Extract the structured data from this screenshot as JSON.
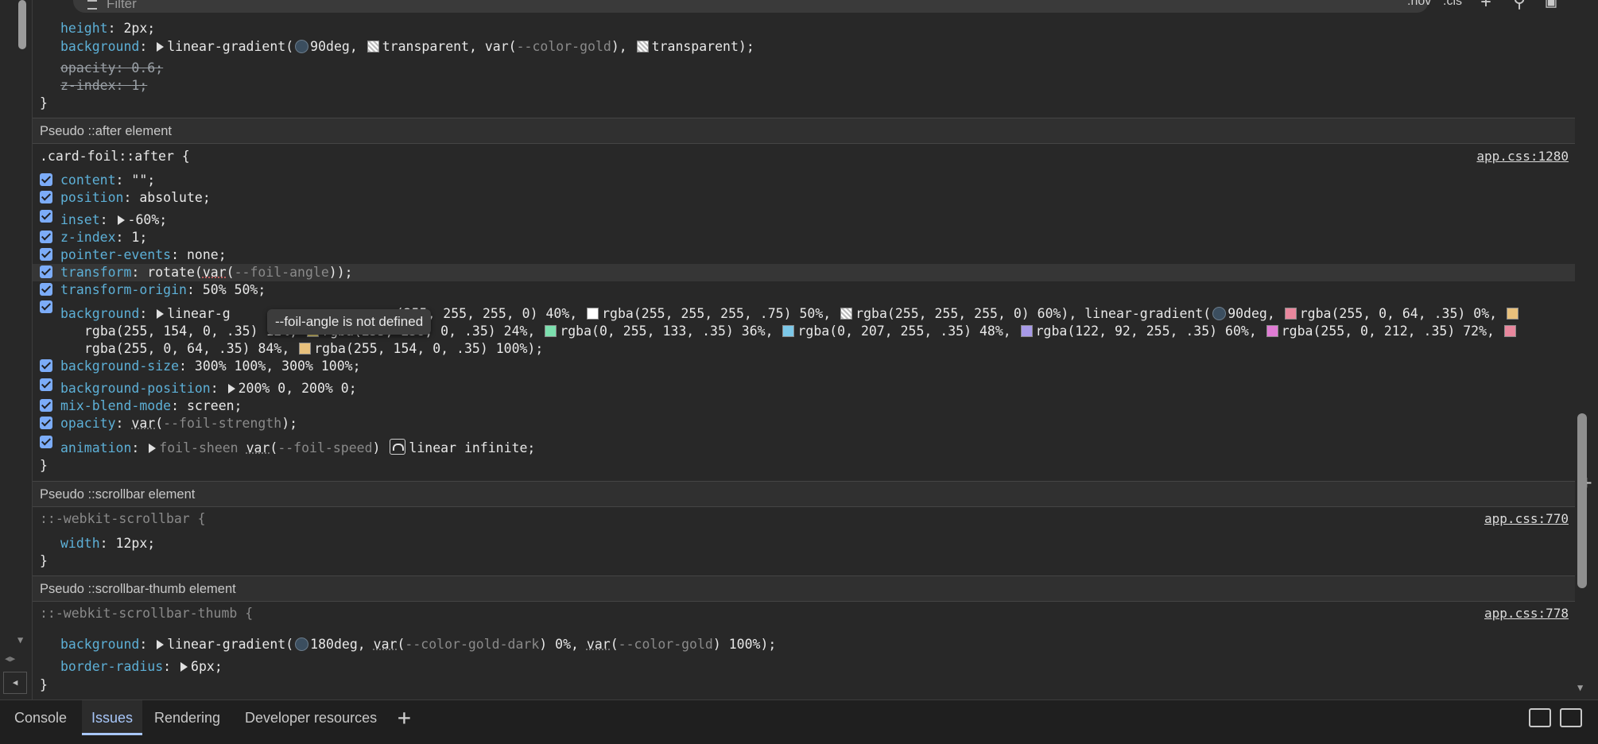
{
  "toolbar": {
    "filter_placeholder": "Filter",
    "hov_label": ":hov",
    "cls_label": ".cls"
  },
  "rule_prev": {
    "lines": [
      {
        "prop": "height",
        "value": "2px;"
      },
      {
        "prop": "background",
        "value_parts": [
          "linear-gradient(",
          "90deg, ",
          "transparent, ",
          "var(",
          "--color-gold",
          "), ",
          "transparent);"
        ]
      },
      {
        "prop": "opacity",
        "value": "0.6;"
      },
      {
        "prop": "z-index",
        "value": "1;"
      }
    ],
    "close": "}"
  },
  "after": {
    "header": "Pseudo ::after element",
    "selector": ".card-foil::after {",
    "source": "app.css:1280",
    "content": {
      "prop": "content",
      "value": "\"\";"
    },
    "position": {
      "prop": "position",
      "value": "absolute;"
    },
    "inset": {
      "prop": "inset",
      "value": "-60%;"
    },
    "zindex": {
      "prop": "z-index",
      "value": "1;"
    },
    "pointer": {
      "prop": "pointer-events",
      "value": "none;"
    },
    "transform": {
      "prop": "transform",
      "v1": "rotate(",
      "v2": "var",
      "v3": "(",
      "v4": "--foil-angle",
      "v5": "));"
    },
    "origin": {
      "prop": "transform-origin",
      "value": "50% 50%;"
    },
    "background": {
      "prop": "background",
      "line1a": "linear-g",
      "line1b": "(255, 255, 255, 0) 40%,",
      "line1c": "rgba(255, 255, 255, .75) 50%,",
      "line1d": "rgba(255, 255, 255, 0) 60%), linear-gradient(",
      "line1e": "90deg,",
      "line1f": "rgba(255, 0, 64, .35) 0%,",
      "line2a": "rgba(255, 154, 0, .35) 12%,",
      "line2b": "rgba(255, 238, 0, .35) 24%,",
      "line2c": "rgba(0, 255, 133, .35) 36%,",
      "line2d": "rgba(0, 207, 255, .35) 48%,",
      "line2e": "rgba(122, 92, 255, .35) 60%,",
      "line2f": "rgba(255, 0, 212, .35) 72%,",
      "line3a": "rgba(255, 0, 64, .35) 84%,",
      "line3b": "rgba(255, 154, 0, .35) 100%);"
    },
    "bgsize": {
      "prop": "background-size",
      "value": "300% 100%, 300% 100%;"
    },
    "bgpos": {
      "prop": "background-position",
      "value": "200% 0, 200% 0;"
    },
    "blend": {
      "prop": "mix-blend-mode",
      "value": "screen;"
    },
    "opacity": {
      "prop": "opacity",
      "v1": "var",
      "v2": "(",
      "v3": "--foil-strength",
      "v4": ");"
    },
    "animation": {
      "prop": "animation",
      "v1": "foil-sheen",
      "v2": "var",
      "v3": "(",
      "v4": "--foil-speed",
      "v5": ")",
      "v6": "linear infinite;"
    },
    "close": "}"
  },
  "tooltip": "--foil-angle is not defined",
  "scrollbar": {
    "header": "Pseudo ::scrollbar element",
    "selector": "::-webkit-scrollbar {",
    "source": "app.css:770",
    "prop": "width",
    "value": "12px;",
    "close": "}"
  },
  "thumb": {
    "header": "Pseudo ::scrollbar-thumb element",
    "selector": "::-webkit-scrollbar-thumb {",
    "source": "app.css:778",
    "bg_prop": "background",
    "bg_v1": "linear-gradient(",
    "bg_v2": "180deg, ",
    "bg_v3": "var",
    "bg_v4": "(",
    "bg_v5": "--color-gold-dark",
    "bg_v6": ") 0%, ",
    "bg_v7": "var",
    "bg_v8": "(",
    "bg_v9": "--color-gold",
    "bg_v10": ") 100%);",
    "br_prop": "border-radius",
    "br_value": "6px;",
    "close": "}"
  },
  "drawer": {
    "tabs": [
      "Console",
      "Issues",
      "Rendering",
      "Developer resources"
    ],
    "active_tab": "Issues"
  },
  "colors": {
    "swatch_white": "#ffffff",
    "swatch_red": "#ff0040",
    "swatch_orange": "#ff9a00",
    "swatch_yellow": "#ffee00",
    "swatch_green": "#00ff85",
    "swatch_cyan": "#00cfff",
    "swatch_violet": "#7a5cff",
    "swatch_magenta": "#ff00d4"
  }
}
